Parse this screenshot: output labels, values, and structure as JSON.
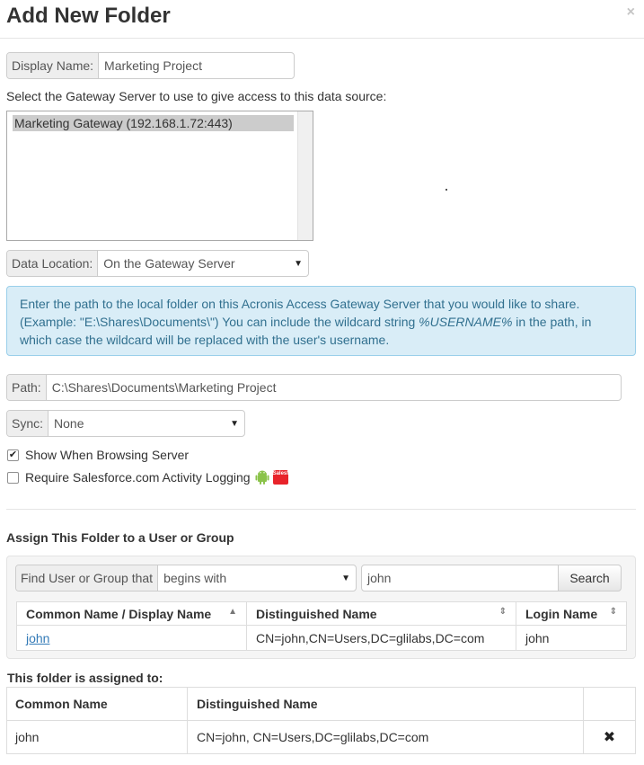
{
  "dialog": {
    "title": "Add New Folder",
    "close_label": "×"
  },
  "display_name": {
    "label": "Display Name:",
    "value": "Marketing Project"
  },
  "gateway": {
    "prompt": "Select the Gateway Server to use to give access to this data source:",
    "options": [
      "Marketing Gateway (192.168.1.72:443)"
    ],
    "selected": "Marketing Gateway (192.168.1.72:443)"
  },
  "data_location": {
    "label": "Data Location:",
    "value": "On the Gateway Server"
  },
  "info": {
    "text_before": "Enter the path to the local folder on this Acronis Access Gateway Server that you would like to share. (Example: \"E:\\Shares\\Documents\\\") You can include the wildcard string ",
    "wildcard": "%USERNAME%",
    "text_after": " in the path, in which case the wildcard will be replaced with the user's username."
  },
  "path": {
    "label": "Path:",
    "value": "C:\\Shares\\Documents\\Marketing Project"
  },
  "sync": {
    "label": "Sync:",
    "value": "None"
  },
  "options": {
    "show_browsing_label": "Show When Browsing Server",
    "show_browsing_checked": true,
    "require_logging_label": "Require Salesforce.com Activity Logging",
    "require_logging_checked": false,
    "salesforce_badge": "Salesforce"
  },
  "assign": {
    "heading": "Assign This Folder to a User or Group",
    "find_label": "Find User or Group that",
    "match_mode": "begins with",
    "search_value": "john",
    "search_button": "Search",
    "columns": [
      "Common Name / Display Name",
      "Distinguished Name",
      "Login Name"
    ],
    "rows": [
      {
        "common_name": "john",
        "distinguished_name": "CN=john,CN=Users,DC=glilabs,DC=com",
        "login_name": "john"
      }
    ]
  },
  "assigned": {
    "heading": "This folder is assigned to:",
    "columns": [
      "Common Name",
      "Distinguished Name"
    ],
    "rows": [
      {
        "common_name": "john",
        "distinguished_name": "CN=john, CN=Users,DC=glilabs,DC=com",
        "remove": "✖"
      }
    ]
  }
}
